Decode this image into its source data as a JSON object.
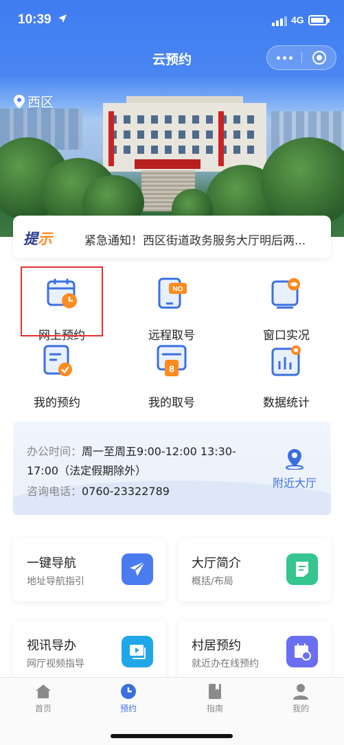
{
  "status_bar": {
    "time": "10:39",
    "network": "4G"
  },
  "header": {
    "title": "云预约"
  },
  "location": {
    "label": "西区"
  },
  "notice": {
    "tag_part1": "提",
    "tag_part2": "示",
    "text": "紧急通知！西区街道政务服务大厅明后两..."
  },
  "grid": [
    {
      "label": "网上预约",
      "icon": "calendar-clock-icon"
    },
    {
      "label": "远程取号",
      "icon": "phone-ticket-icon"
    },
    {
      "label": "窗口实况",
      "icon": "window-live-icon"
    },
    {
      "label": "我的预约",
      "icon": "document-check-icon"
    },
    {
      "label": "我的取号",
      "icon": "ticket-number-icon"
    },
    {
      "label": "数据统计",
      "icon": "bar-chart-icon"
    }
  ],
  "ticket_number": "8",
  "ticket_badge": "NO",
  "office": {
    "hours_label": "办公时间：",
    "hours_value": "周一至周五9:00-12:00 13:30-17:00（法定假期除外）",
    "phone_label": "咨询电话：",
    "phone_value": "0760-23322789",
    "nearby_label": "附近大厅"
  },
  "cards": [
    {
      "title": "一键导航",
      "subtitle": "地址导航指引",
      "icon": "paper-plane-icon",
      "color": "#4a7cf0"
    },
    {
      "title": "大厅简介",
      "subtitle": "概括/布局",
      "icon": "note-icon",
      "color": "#35c58f"
    },
    {
      "title": "视讯导办",
      "subtitle": "网厅视频指导",
      "icon": "video-icon",
      "color": "#1fa7e8"
    },
    {
      "title": "村居预约",
      "subtitle": "就近办在线预约",
      "icon": "calendar-icon",
      "color": "#6a6ef0"
    }
  ],
  "tabbar": [
    {
      "label": "首页",
      "icon": "home-icon",
      "active": false
    },
    {
      "label": "预约",
      "icon": "clock-icon",
      "active": true
    },
    {
      "label": "指南",
      "icon": "book-icon",
      "active": false
    },
    {
      "label": "我的",
      "icon": "user-icon",
      "active": false
    }
  ],
  "colors": {
    "primary": "#3a6fe0",
    "accent": "#ff8a1f",
    "highlight_border": "#e53030"
  }
}
